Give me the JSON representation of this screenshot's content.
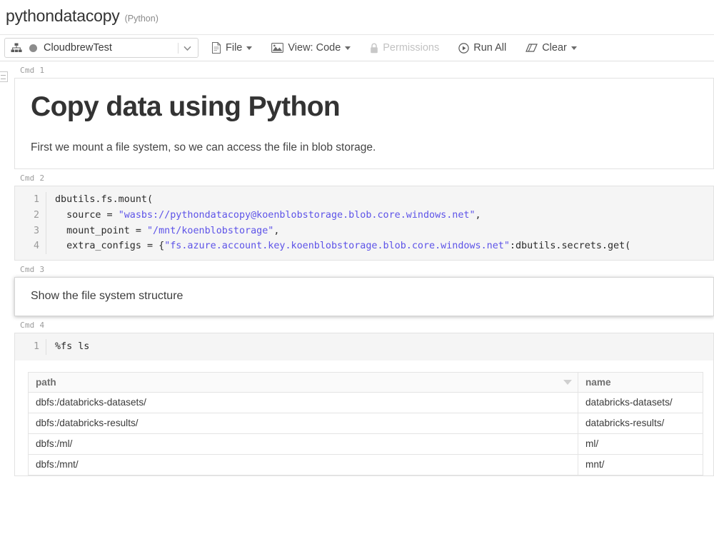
{
  "notebook": {
    "title": "pythondatacopy",
    "language": "(Python)"
  },
  "toolbar": {
    "cluster": {
      "name": "CloudbrewTest",
      "icon": "cluster-icon",
      "status_color": "#8c8c8c"
    },
    "items": [
      {
        "label": "File",
        "icon": "file-icon",
        "caret": true,
        "disabled": false
      },
      {
        "label": "View: Code",
        "icon": "image-icon",
        "caret": true,
        "disabled": false
      },
      {
        "label": "Permissions",
        "icon": "lock-icon",
        "caret": false,
        "disabled": true
      },
      {
        "label": "Run All",
        "icon": "play-circle-icon",
        "caret": false,
        "disabled": false
      },
      {
        "label": "Clear",
        "icon": "eraser-icon",
        "caret": true,
        "disabled": false
      }
    ]
  },
  "cells": [
    {
      "label": "Cmd",
      "number": "1",
      "type": "markdown",
      "heading": "Copy data using Python",
      "paragraph": "First we mount a file system, so we can access the file in blob storage."
    },
    {
      "label": "Cmd",
      "number": "2",
      "type": "code",
      "lines": [
        {
          "n": "1",
          "segments": [
            {
              "text": "dbutils.fs.mount(",
              "style": "plain"
            }
          ]
        },
        {
          "n": "2",
          "segments": [
            {
              "text": "  source = ",
              "style": "plain"
            },
            {
              "text": "\"wasbs://pythondatacopy@koenblobstorage.blob.core.windows.net\"",
              "style": "string"
            },
            {
              "text": ",",
              "style": "plain"
            }
          ]
        },
        {
          "n": "3",
          "segments": [
            {
              "text": "  mount_point = ",
              "style": "plain"
            },
            {
              "text": "\"/mnt/koenblobstorage\"",
              "style": "string"
            },
            {
              "text": ",",
              "style": "plain"
            }
          ]
        },
        {
          "n": "4",
          "segments": [
            {
              "text": "  extra_configs = {",
              "style": "plain"
            },
            {
              "text": "\"fs.azure.account.key.koenblobstorage.blob.core.windows.net\"",
              "style": "string"
            },
            {
              "text": ":dbutils.secrets.get(",
              "style": "plain"
            }
          ]
        }
      ]
    },
    {
      "label": "Cmd",
      "number": "3",
      "type": "markdown_plain",
      "selected": true,
      "text": "Show the file system structure"
    },
    {
      "label": "Cmd",
      "number": "4",
      "type": "code_with_result",
      "lines": [
        {
          "n": "1",
          "segments": [
            {
              "text": "%fs ls",
              "style": "plain"
            }
          ]
        }
      ],
      "result": {
        "columns": [
          "path",
          "name"
        ],
        "sort_caret_on": "path",
        "rows": [
          [
            "dbfs:/databricks-datasets/",
            "databricks-datasets/"
          ],
          [
            "dbfs:/databricks-results/",
            "databricks-results/"
          ],
          [
            "dbfs:/ml/",
            "ml/"
          ],
          [
            "dbfs:/mnt/",
            "mnt/"
          ]
        ]
      }
    }
  ]
}
